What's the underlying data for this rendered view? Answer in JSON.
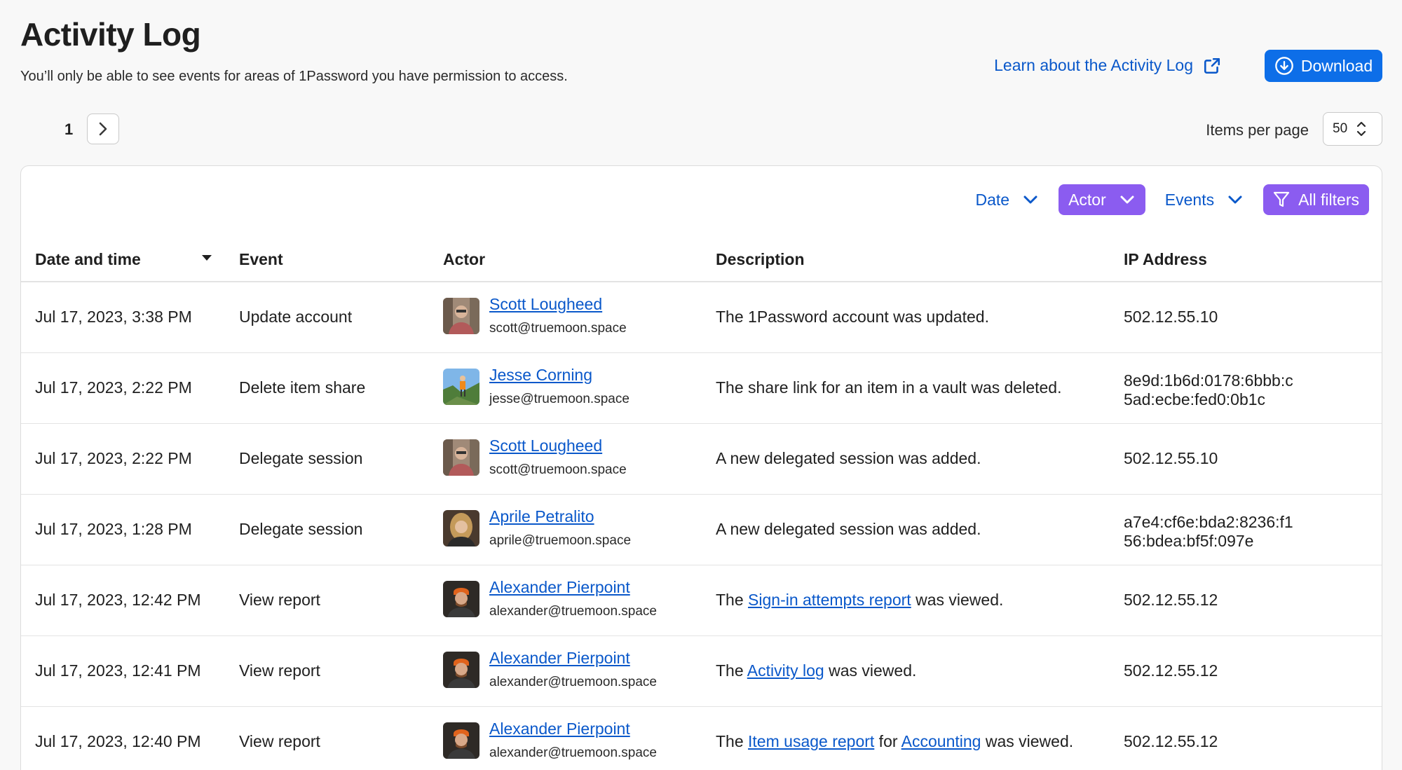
{
  "header": {
    "title": "Activity Log",
    "subtitle": "You’ll only be able to see events for areas of 1Password you have permission to access.",
    "learn_link": "Learn about the Activity Log",
    "download_label": "Download"
  },
  "pagination": {
    "current_page": "1",
    "items_per_page_label": "Items per page",
    "items_per_page_value": "50"
  },
  "filters": {
    "date": "Date",
    "actor": "Actor",
    "events": "Events",
    "all_filters": "All filters"
  },
  "columns": [
    "Date and time",
    "Event",
    "Actor",
    "Description",
    "IP Address"
  ],
  "rows": [
    {
      "date": "Jul 17, 2023, 3:38 PM",
      "event": "Update account",
      "actor_name": "Scott Lougheed",
      "actor_email": "scott@truemoon.space",
      "desc": {
        "pre": "The 1Password account was updated.",
        "link1": "",
        "mid": "",
        "link2": "",
        "post": ""
      },
      "ip_line1": "502.12.55.10",
      "ip_line2": ""
    },
    {
      "date": "Jul 17, 2023, 2:22 PM",
      "event": "Delete item share",
      "actor_name": "Jesse Corning",
      "actor_email": "jesse@truemoon.space",
      "desc": {
        "pre": "The share link for an item in a vault was deleted.",
        "link1": "",
        "mid": "",
        "link2": "",
        "post": ""
      },
      "ip_line1": "8e9d:1b6d:0178:6bbb:c",
      "ip_line2": "5ad:ecbe:fed0:0b1c"
    },
    {
      "date": "Jul 17, 2023, 2:22 PM",
      "event": "Delegate session",
      "actor_name": "Scott Lougheed",
      "actor_email": "scott@truemoon.space",
      "desc": {
        "pre": "A new delegated session was added.",
        "link1": "",
        "mid": "",
        "link2": "",
        "post": ""
      },
      "ip_line1": "502.12.55.10",
      "ip_line2": ""
    },
    {
      "date": "Jul 17, 2023, 1:28 PM",
      "event": "Delegate session",
      "actor_name": "Aprile Petralito",
      "actor_email": "aprile@truemoon.space",
      "desc": {
        "pre": "A new delegated session was added.",
        "link1": "",
        "mid": "",
        "link2": "",
        "post": ""
      },
      "ip_line1": "a7e4:cf6e:bda2:8236:f1",
      "ip_line2": "56:bdea:bf5f:097e"
    },
    {
      "date": "Jul 17, 2023, 12:42 PM",
      "event": "View report",
      "actor_name": "Alexander Pierpoint",
      "actor_email": "alexander@truemoon.space",
      "desc": {
        "pre": "The ",
        "link1": "Sign-in attempts report",
        "mid": " was viewed.",
        "link2": "",
        "post": ""
      },
      "ip_line1": "502.12.55.12",
      "ip_line2": ""
    },
    {
      "date": "Jul 17, 2023, 12:41 PM",
      "event": "View report",
      "actor_name": "Alexander Pierpoint",
      "actor_email": "alexander@truemoon.space",
      "desc": {
        "pre": "The ",
        "link1": "Activity log",
        "mid": " was viewed.",
        "link2": "",
        "post": ""
      },
      "ip_line1": "502.12.55.12",
      "ip_line2": ""
    },
    {
      "date": "Jul 17, 2023, 12:40 PM",
      "event": "View report",
      "actor_name": "Alexander Pierpoint",
      "actor_email": "alexander@truemoon.space",
      "desc": {
        "pre": "The ",
        "link1": "Item usage report",
        "mid": " for ",
        "link2": "Accounting",
        "post": " was viewed."
      },
      "ip_line1": "502.12.55.12",
      "ip_line2": ""
    }
  ],
  "colors": {
    "primary_blue": "#0d6ee8",
    "link_blue": "#0a58ca",
    "purple_filter": "#8b5cf0"
  }
}
